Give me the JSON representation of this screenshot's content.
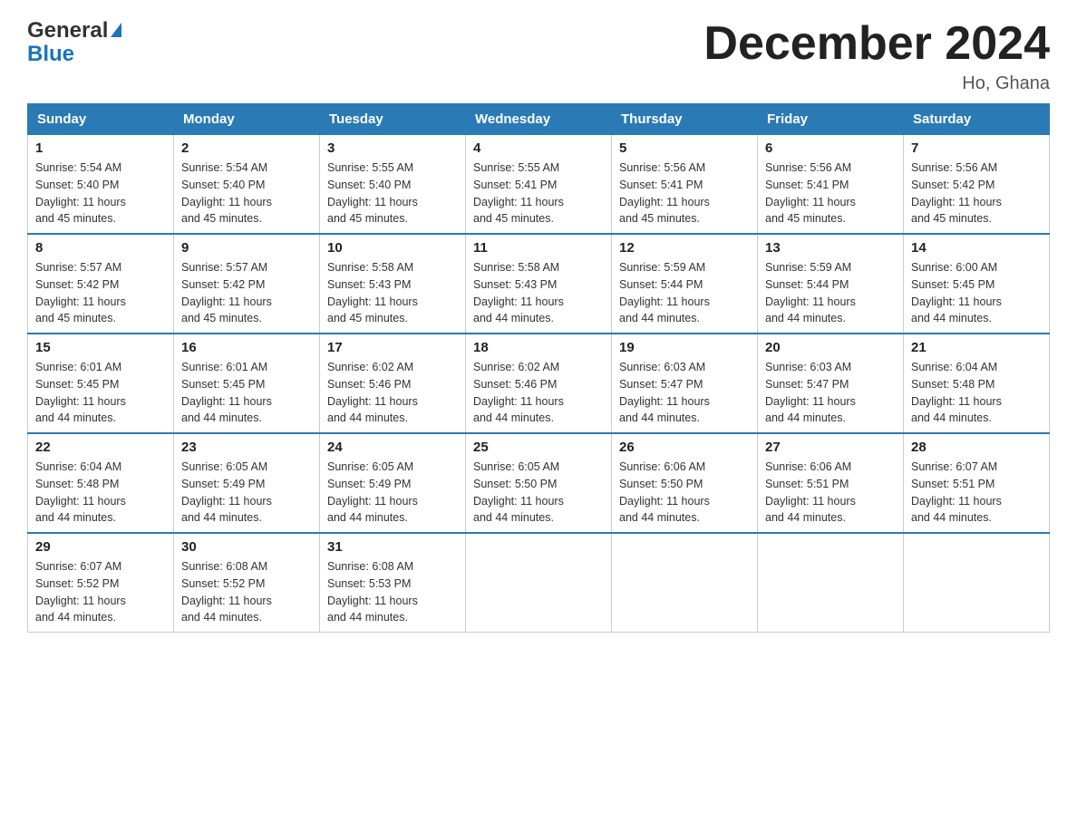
{
  "logo": {
    "general": "General",
    "blue": "Blue"
  },
  "title": {
    "month_year": "December 2024",
    "location": "Ho, Ghana"
  },
  "header": {
    "days": [
      "Sunday",
      "Monday",
      "Tuesday",
      "Wednesday",
      "Thursday",
      "Friday",
      "Saturday"
    ]
  },
  "weeks": [
    [
      {
        "day": "1",
        "sunrise": "5:54 AM",
        "sunset": "5:40 PM",
        "daylight": "11 hours and 45 minutes."
      },
      {
        "day": "2",
        "sunrise": "5:54 AM",
        "sunset": "5:40 PM",
        "daylight": "11 hours and 45 minutes."
      },
      {
        "day": "3",
        "sunrise": "5:55 AM",
        "sunset": "5:40 PM",
        "daylight": "11 hours and 45 minutes."
      },
      {
        "day": "4",
        "sunrise": "5:55 AM",
        "sunset": "5:41 PM",
        "daylight": "11 hours and 45 minutes."
      },
      {
        "day": "5",
        "sunrise": "5:56 AM",
        "sunset": "5:41 PM",
        "daylight": "11 hours and 45 minutes."
      },
      {
        "day": "6",
        "sunrise": "5:56 AM",
        "sunset": "5:41 PM",
        "daylight": "11 hours and 45 minutes."
      },
      {
        "day": "7",
        "sunrise": "5:56 AM",
        "sunset": "5:42 PM",
        "daylight": "11 hours and 45 minutes."
      }
    ],
    [
      {
        "day": "8",
        "sunrise": "5:57 AM",
        "sunset": "5:42 PM",
        "daylight": "11 hours and 45 minutes."
      },
      {
        "day": "9",
        "sunrise": "5:57 AM",
        "sunset": "5:42 PM",
        "daylight": "11 hours and 45 minutes."
      },
      {
        "day": "10",
        "sunrise": "5:58 AM",
        "sunset": "5:43 PM",
        "daylight": "11 hours and 45 minutes."
      },
      {
        "day": "11",
        "sunrise": "5:58 AM",
        "sunset": "5:43 PM",
        "daylight": "11 hours and 44 minutes."
      },
      {
        "day": "12",
        "sunrise": "5:59 AM",
        "sunset": "5:44 PM",
        "daylight": "11 hours and 44 minutes."
      },
      {
        "day": "13",
        "sunrise": "5:59 AM",
        "sunset": "5:44 PM",
        "daylight": "11 hours and 44 minutes."
      },
      {
        "day": "14",
        "sunrise": "6:00 AM",
        "sunset": "5:45 PM",
        "daylight": "11 hours and 44 minutes."
      }
    ],
    [
      {
        "day": "15",
        "sunrise": "6:01 AM",
        "sunset": "5:45 PM",
        "daylight": "11 hours and 44 minutes."
      },
      {
        "day": "16",
        "sunrise": "6:01 AM",
        "sunset": "5:45 PM",
        "daylight": "11 hours and 44 minutes."
      },
      {
        "day": "17",
        "sunrise": "6:02 AM",
        "sunset": "5:46 PM",
        "daylight": "11 hours and 44 minutes."
      },
      {
        "day": "18",
        "sunrise": "6:02 AM",
        "sunset": "5:46 PM",
        "daylight": "11 hours and 44 minutes."
      },
      {
        "day": "19",
        "sunrise": "6:03 AM",
        "sunset": "5:47 PM",
        "daylight": "11 hours and 44 minutes."
      },
      {
        "day": "20",
        "sunrise": "6:03 AM",
        "sunset": "5:47 PM",
        "daylight": "11 hours and 44 minutes."
      },
      {
        "day": "21",
        "sunrise": "6:04 AM",
        "sunset": "5:48 PM",
        "daylight": "11 hours and 44 minutes."
      }
    ],
    [
      {
        "day": "22",
        "sunrise": "6:04 AM",
        "sunset": "5:48 PM",
        "daylight": "11 hours and 44 minutes."
      },
      {
        "day": "23",
        "sunrise": "6:05 AM",
        "sunset": "5:49 PM",
        "daylight": "11 hours and 44 minutes."
      },
      {
        "day": "24",
        "sunrise": "6:05 AM",
        "sunset": "5:49 PM",
        "daylight": "11 hours and 44 minutes."
      },
      {
        "day": "25",
        "sunrise": "6:05 AM",
        "sunset": "5:50 PM",
        "daylight": "11 hours and 44 minutes."
      },
      {
        "day": "26",
        "sunrise": "6:06 AM",
        "sunset": "5:50 PM",
        "daylight": "11 hours and 44 minutes."
      },
      {
        "day": "27",
        "sunrise": "6:06 AM",
        "sunset": "5:51 PM",
        "daylight": "11 hours and 44 minutes."
      },
      {
        "day": "28",
        "sunrise": "6:07 AM",
        "sunset": "5:51 PM",
        "daylight": "11 hours and 44 minutes."
      }
    ],
    [
      {
        "day": "29",
        "sunrise": "6:07 AM",
        "sunset": "5:52 PM",
        "daylight": "11 hours and 44 minutes."
      },
      {
        "day": "30",
        "sunrise": "6:08 AM",
        "sunset": "5:52 PM",
        "daylight": "11 hours and 44 minutes."
      },
      {
        "day": "31",
        "sunrise": "6:08 AM",
        "sunset": "5:53 PM",
        "daylight": "11 hours and 44 minutes."
      },
      null,
      null,
      null,
      null
    ]
  ],
  "labels": {
    "sunrise": "Sunrise:",
    "sunset": "Sunset:",
    "daylight": "Daylight:"
  }
}
